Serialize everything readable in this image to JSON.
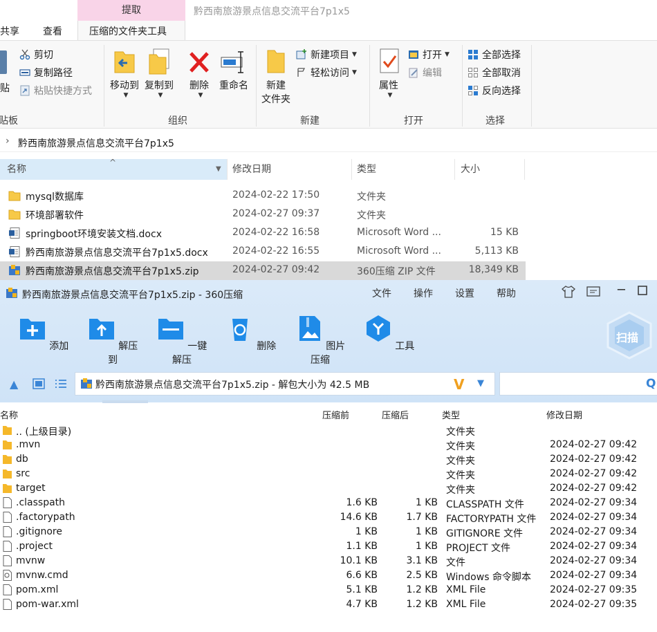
{
  "explorer": {
    "context_header": "提取",
    "window_title": "黔西南旅游景点信息交流平台7p1x5",
    "tabs": [
      "共享",
      "查看",
      "压缩的文件夹工具"
    ],
    "ribbon": {
      "clipboard": {
        "cut": "剪切",
        "copy_path": "复制路径",
        "paste_shortcut": "粘贴快捷方式",
        "paste_partial": "贴",
        "group_partial": "贴板"
      },
      "organize": {
        "move_to": "移动到",
        "copy_to": "复制到",
        "delete": "删除",
        "rename": "重命名",
        "group": "组织"
      },
      "new": {
        "new_folder_line1": "新建",
        "new_folder_line2": "文件夹",
        "new_item": "新建项目",
        "easy_access": "轻松访问",
        "group": "新建"
      },
      "open": {
        "properties": "属性",
        "open": "打开",
        "edit": "编辑",
        "group": "打开"
      },
      "select": {
        "select_all": "全部选择",
        "select_none": "全部取消",
        "invert": "反向选择",
        "group": "选择"
      }
    },
    "address": "黔西南旅游景点信息交流平台7p1x5",
    "columns": {
      "name": "名称",
      "date": "修改日期",
      "type": "类型",
      "size": "大小"
    },
    "files": [
      {
        "name": "mysql数据库",
        "date": "2024-02-22 17:50",
        "type": "文件夹",
        "size": "",
        "icon": "folder"
      },
      {
        "name": "环境部署软件",
        "date": "2024-02-27 09:37",
        "type": "文件夹",
        "size": "",
        "icon": "folder"
      },
      {
        "name": "springboot环境安装文档.docx",
        "date": "2024-02-22 16:58",
        "type": "Microsoft Word ...",
        "size": "15 KB",
        "icon": "docx"
      },
      {
        "name": "黔西南旅游景点信息交流平台7p1x5.docx",
        "date": "2024-02-22 16:55",
        "type": "Microsoft Word ...",
        "size": "5,113 KB",
        "icon": "docx"
      },
      {
        "name": "黔西南旅游景点信息交流平台7p1x5.zip",
        "date": "2024-02-27 09:42",
        "type": "360压缩 ZIP 文件",
        "size": "18,349 KB",
        "icon": "zip"
      }
    ]
  },
  "zip": {
    "title": "黔西南旅游景点信息交流平台7p1x5.zip - 360压缩",
    "menu": [
      "文件",
      "操作",
      "设置",
      "帮助"
    ],
    "tools": [
      "添加",
      "解压到",
      "一键解压",
      "删除",
      "图片压缩",
      "工具"
    ],
    "scan": "扫描",
    "path": "黔西南旅游景点信息交流平台7p1x5.zip - 解包大小为 42.5 MB",
    "columns": {
      "name": "名称",
      "pre": "压缩前",
      "post": "压缩后",
      "type": "类型",
      "date": "修改日期"
    },
    "rows": [
      {
        "name": ".. (上级目录)",
        "pre": "",
        "post": "",
        "type": "文件夹",
        "date": "",
        "icon": "folder"
      },
      {
        "name": ".mvn",
        "pre": "",
        "post": "",
        "type": "文件夹",
        "date": "2024-02-27 09:42",
        "icon": "folder"
      },
      {
        "name": "db",
        "pre": "",
        "post": "",
        "type": "文件夹",
        "date": "2024-02-27 09:42",
        "icon": "folder"
      },
      {
        "name": "src",
        "pre": "",
        "post": "",
        "type": "文件夹",
        "date": "2024-02-27 09:42",
        "icon": "folder"
      },
      {
        "name": "target",
        "pre": "",
        "post": "",
        "type": "文件夹",
        "date": "2024-02-27 09:42",
        "icon": "folder"
      },
      {
        "name": ".classpath",
        "pre": "1.6 KB",
        "post": "1 KB",
        "type": "CLASSPATH 文件",
        "date": "2024-02-27 09:34",
        "icon": "file"
      },
      {
        "name": ".factorypath",
        "pre": "14.6 KB",
        "post": "1.7 KB",
        "type": "FACTORYPATH 文件",
        "date": "2024-02-27 09:34",
        "icon": "file"
      },
      {
        "name": ".gitignore",
        "pre": "1 KB",
        "post": "1 KB",
        "type": "GITIGNORE 文件",
        "date": "2024-02-27 09:34",
        "icon": "file"
      },
      {
        "name": ".project",
        "pre": "1.1 KB",
        "post": "1 KB",
        "type": "PROJECT 文件",
        "date": "2024-02-27 09:34",
        "icon": "file"
      },
      {
        "name": "mvnw",
        "pre": "10.1 KB",
        "post": "3.1 KB",
        "type": "文件",
        "date": "2024-02-27 09:34",
        "icon": "file"
      },
      {
        "name": "mvnw.cmd",
        "pre": "6.6 KB",
        "post": "2.5 KB",
        "type": "Windows 命令脚本",
        "date": "2024-02-27 09:34",
        "icon": "cmd"
      },
      {
        "name": "pom.xml",
        "pre": "5.1 KB",
        "post": "1.2 KB",
        "type": "XML File",
        "date": "2024-02-27 09:35",
        "icon": "file"
      },
      {
        "name": "pom-war.xml",
        "pre": "4.7 KB",
        "post": "1.2 KB",
        "type": "XML File",
        "date": "2024-02-27 09:35",
        "icon": "file"
      }
    ]
  }
}
